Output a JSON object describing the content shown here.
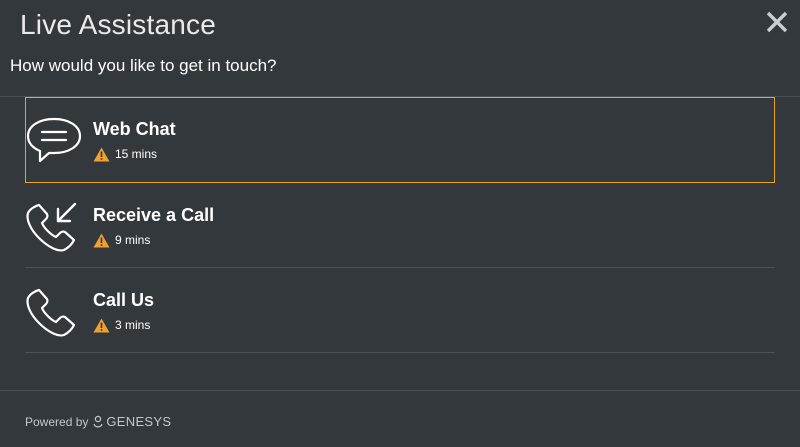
{
  "header": {
    "title": "Live Assistance",
    "subtitle": "How would you like to get in touch?",
    "close_icon": "close-icon"
  },
  "options": [
    {
      "label": "Web Chat",
      "wait": "15 mins",
      "icon": "chat-bubble-icon",
      "selected": true
    },
    {
      "label": "Receive a Call",
      "wait": "9 mins",
      "icon": "phone-incoming-icon",
      "selected": false
    },
    {
      "label": "Call Us",
      "wait": "3 mins",
      "icon": "phone-icon",
      "selected": false
    }
  ],
  "footer": {
    "powered_by": "Powered by",
    "brand": "GENESYS"
  },
  "colors": {
    "background": "#33383d",
    "accent_border": "#e8a51e",
    "warning": "#f0a030"
  }
}
